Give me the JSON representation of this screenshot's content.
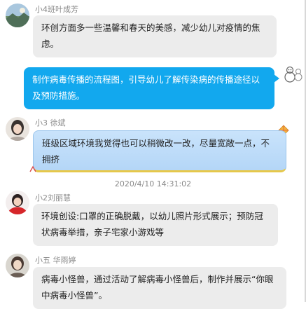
{
  "messages": [
    {
      "sender": "小4班叶成芳",
      "avatar_icon": "avatar-landscape-icon",
      "text": "环创方面多一些温馨和春天的美感，减少幼儿对疫情的焦虑。"
    },
    {
      "sender": "",
      "self": true,
      "avatar_icon": "snowman-doodle-icon",
      "text": "制作病毒传播的流程图，引导幼儿了解传染病的传播途径以及预防措施。"
    },
    {
      "sender": "小3 徐斌",
      "avatar_icon": "avatar-portrait-icon",
      "text": "班级区域环境我觉得也可以稍微改一改，尽量宽敞一点，不拥挤"
    },
    {
      "sender": "小2刘丽慧",
      "avatar_icon": "avatar-child-red-icon",
      "text": "环境创设:口罩的正确脱戴，以幼儿照片形式展示；预防冠状病毒举措，亲子宅家小游戏等"
    },
    {
      "sender": "小五 华雨婷",
      "avatar_icon": "avatar-portrait-icon",
      "text": "病毒小怪兽，通过活动了解病毒小怪兽后，制作并展示“你眼中病毒小怪兽”。"
    }
  ],
  "timestamp": "2020/4/10 14:31:02",
  "colors": {
    "self_bubble": "#12a8ee",
    "other_bubble": "#ececec",
    "themed_bubble": "#c9e3fb",
    "name_text": "#8a8a8a"
  }
}
